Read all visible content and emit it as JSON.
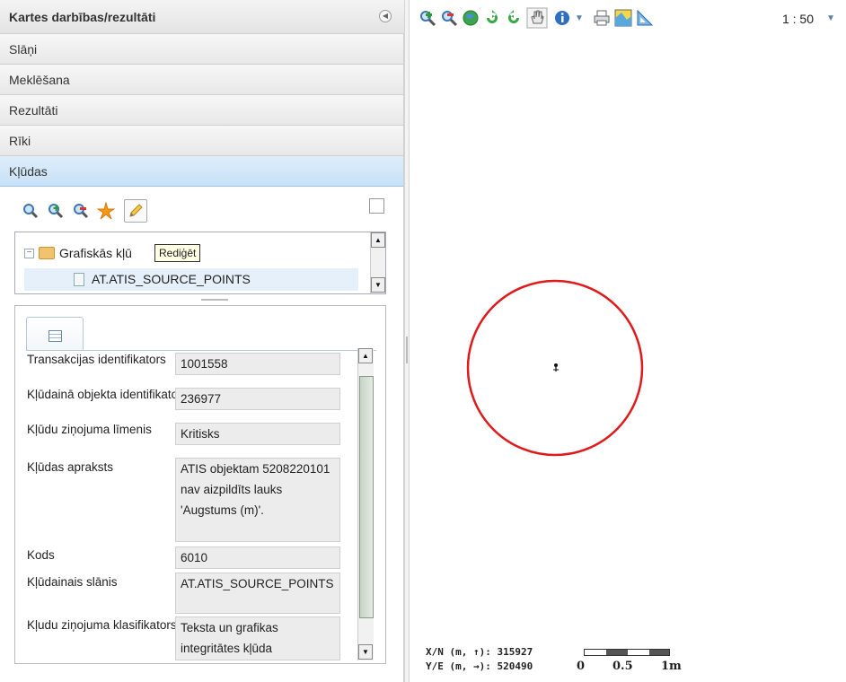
{
  "panel": {
    "title": "Kartes darbības/rezultāti",
    "sections": [
      "Slāņi",
      "Meklēšana",
      "Rezultāti",
      "Rīki",
      "Kļūdas"
    ]
  },
  "tree": {
    "folder_label": "Grafiskās kļū",
    "item_label": "AT.ATIS_SOURCE_POINTS",
    "tooltip": "Rediģēt"
  },
  "fields": [
    {
      "label": "Transakcijas identifikators",
      "value": "1001558"
    },
    {
      "label": "Kļūdainā objekta identifikators",
      "value": "236977"
    },
    {
      "label": "Kļūdu ziņojuma līmenis",
      "value": "Kritisks"
    },
    {
      "label": "Kļūdas apraksts",
      "value": "ATIS objektam 5208220101 nav aizpildīts lauks 'Augstums (m)'."
    },
    {
      "label": "Kods",
      "value": "6010"
    },
    {
      "label": "Kļūdainais slānis",
      "value": "AT.ATIS_SOURCE_POINTS"
    },
    {
      "label": "Kļudu ziņojuma klasifikators",
      "value": "Teksta un grafikas integritātes kļūda"
    }
  ],
  "map": {
    "scale": "1 : 50",
    "coord_y": "X/N (m, ↑): 315927",
    "coord_x": "Y/E (m, →): 520490",
    "scalebar_labels": [
      "0",
      "0.5",
      "1m"
    ],
    "marker_color": "#e0191b"
  }
}
